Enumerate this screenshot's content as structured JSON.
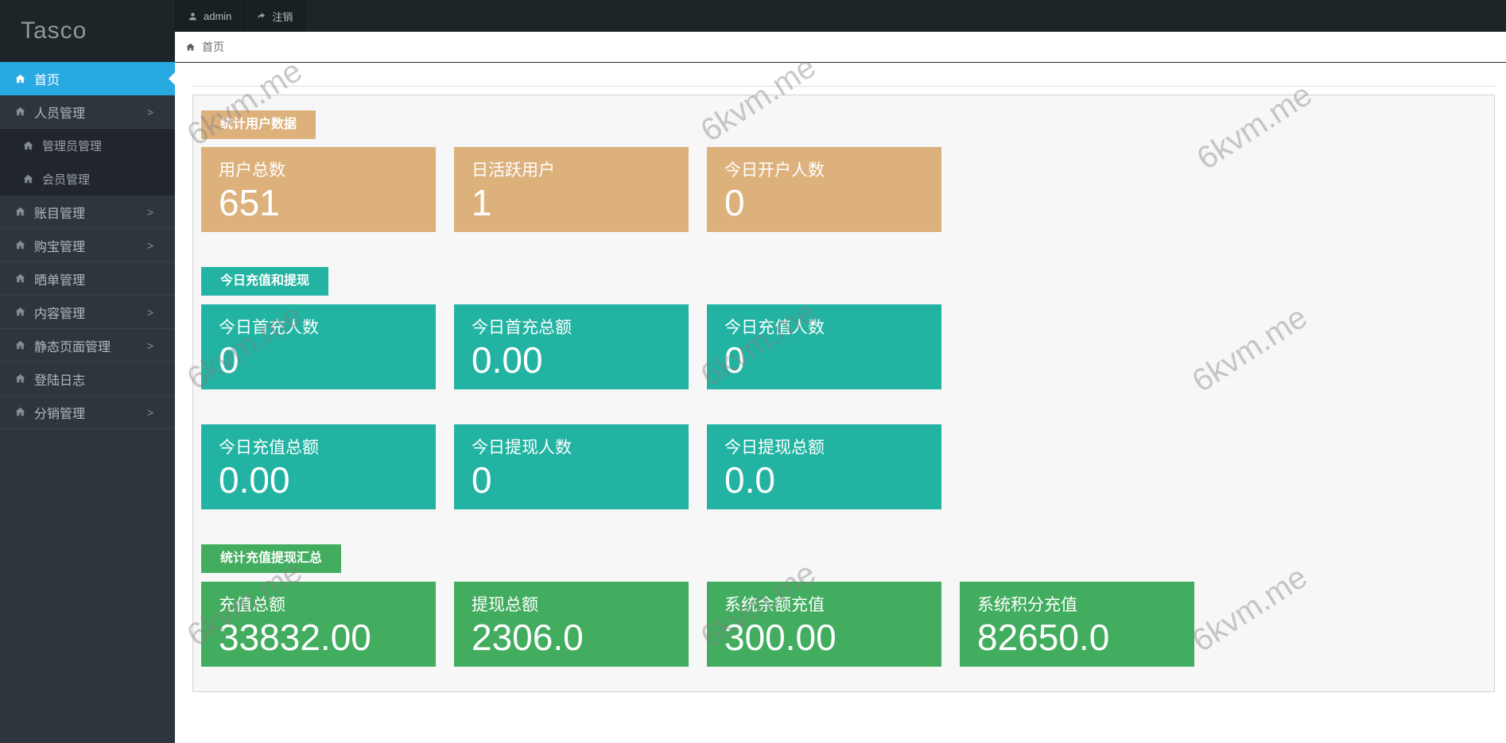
{
  "brand": "Tasco",
  "topbar": {
    "user": "admin",
    "logout": "注销"
  },
  "breadcrumb": {
    "home": "首页"
  },
  "watermark": {
    "text": "6kvm.me"
  },
  "sidebar": {
    "chevron": ">",
    "items": [
      {
        "label": "首页"
      },
      {
        "label": "人员管理"
      },
      {
        "label": "管理员管理"
      },
      {
        "label": "会员管理"
      },
      {
        "label": "账目管理"
      },
      {
        "label": "购宝管理"
      },
      {
        "label": "晒单管理"
      },
      {
        "label": "内容管理"
      },
      {
        "label": "静态页面管理"
      },
      {
        "label": "登陆日志"
      },
      {
        "label": "分销管理"
      }
    ]
  },
  "sections": [
    {
      "title": "统计用户数据",
      "color": "#ddb17c",
      "cards": [
        {
          "label": "用户总数",
          "value": "651"
        },
        {
          "label": "日活跃用户",
          "value": "1"
        },
        {
          "label": "今日开户人数",
          "value": "0"
        }
      ]
    },
    {
      "title": "今日充值和提现",
      "color": "#22b3a2",
      "cards": [
        {
          "label": "今日首充人数",
          "value": "0"
        },
        {
          "label": "今日首充总额",
          "value": "0.00"
        },
        {
          "label": "今日充值人数",
          "value": "0"
        },
        {
          "label": "今日充值总额",
          "value": "0.00"
        },
        {
          "label": "今日提现人数",
          "value": "0"
        },
        {
          "label": "今日提现总额",
          "value": "0.0"
        }
      ]
    },
    {
      "title": "统计充值提现汇总",
      "color": "#42ad5f",
      "cards": [
        {
          "label": "充值总额",
          "value": "33832.00"
        },
        {
          "label": "提现总额",
          "value": "2306.0"
        },
        {
          "label": "系统余额充值",
          "value": "300.00"
        },
        {
          "label": "系统积分充值",
          "value": "82650.0"
        }
      ]
    }
  ]
}
